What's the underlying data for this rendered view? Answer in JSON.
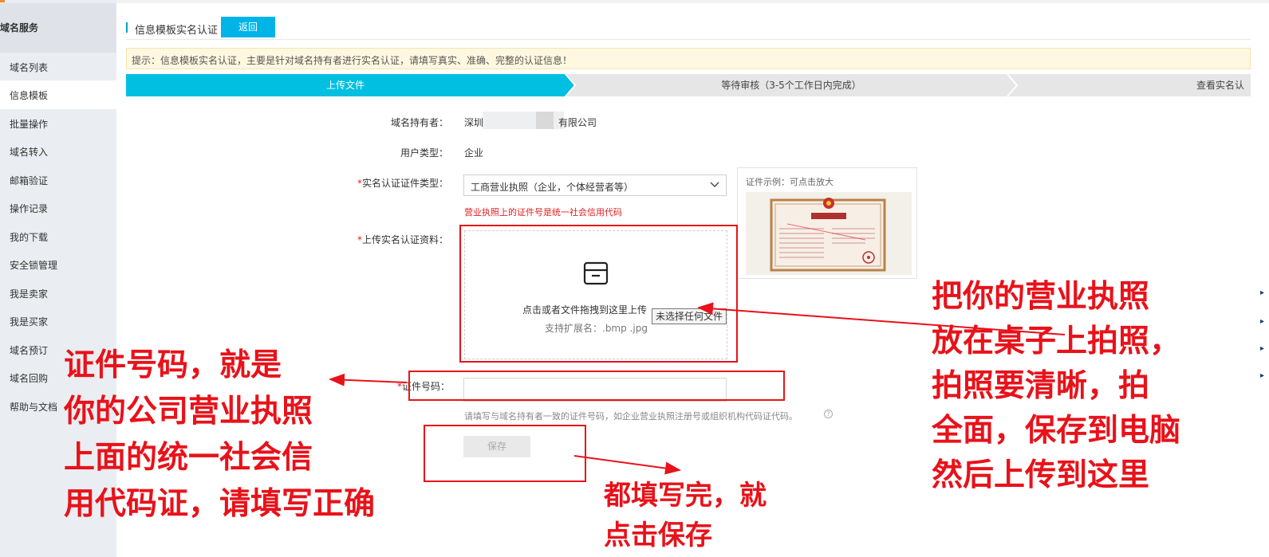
{
  "sidebar": {
    "header": "域名服务",
    "items": [
      {
        "label": "域名列表",
        "active": false
      },
      {
        "label": "信息模板",
        "active": true
      },
      {
        "label": "批量操作",
        "active": false
      },
      {
        "label": "域名转入",
        "active": false
      },
      {
        "label": "邮箱验证",
        "active": false
      },
      {
        "label": "操作记录",
        "active": false
      },
      {
        "label": "我的下载",
        "active": false
      },
      {
        "label": "安全锁管理",
        "active": false
      },
      {
        "label": "我是卖家",
        "active": false
      },
      {
        "label": "我是买家",
        "active": false
      },
      {
        "label": "域名预订",
        "active": false
      },
      {
        "label": "域名回购",
        "active": false
      },
      {
        "label": "帮助与文档",
        "active": false
      }
    ]
  },
  "header": {
    "title": "信息模板实名认证",
    "back_label": "返回"
  },
  "tip": "提示：信息模板实名认证，主要是针对域名持有者进行实名认证，请填写真实、准确、完整的认证信息！",
  "steps": [
    {
      "label": "上传文件",
      "active": true
    },
    {
      "label": "等待审核（3-5个工作日内完成）",
      "active": false
    },
    {
      "label": "查看实名认",
      "active": false
    }
  ],
  "form": {
    "holder_label": "域名持有者：",
    "holder_value_start": "深圳",
    "holder_value_end": "有限公司",
    "usertype_label": "用户类型：",
    "usertype_value": "企业",
    "doctype_label": "实名认证证件类型：",
    "doctype_value": "工商营业执照（企业，个体经营者等）",
    "doctype_hint": "营业执照上的证件号是统一社会信用代码",
    "sample_label": "证件示例：可点击放大",
    "upload_label": "上传实名认证资料：",
    "upload_text": "点击或者文件拖拽到这里上传",
    "upload_ext": "支持扩展名：.bmp .jpg",
    "file_tooltip": "未选择任何文件",
    "certno_label": "证件号码：",
    "certno_value": "",
    "certno_hint": "请填写与域名持有者一致的证件号码，如企业营业执照注册号或组织机构代码证代码。",
    "save_label": "保存"
  },
  "annotations": {
    "left": [
      "证件号码，就是",
      "你的公司营业执照",
      "上面的统一社会信",
      "用代码证，请填写正确"
    ],
    "right": [
      "把你的营业执照",
      "放在桌子上拍照，",
      "拍照要清晰，拍",
      "全面，保存到电脑",
      "然后上传到这里"
    ],
    "bottom": [
      "都填写完，就",
      "点击保存"
    ]
  },
  "colors": {
    "accent": "#00b4e8",
    "step_active": "#00bfe0",
    "annotation": "#e8121a",
    "error": "#e02020"
  }
}
